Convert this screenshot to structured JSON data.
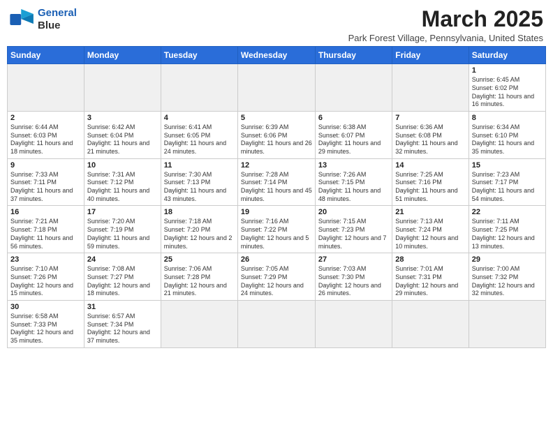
{
  "logo": {
    "line1": "General",
    "line2": "Blue"
  },
  "title": "March 2025",
  "location": "Park Forest Village, Pennsylvania, United States",
  "days_of_week": [
    "Sunday",
    "Monday",
    "Tuesday",
    "Wednesday",
    "Thursday",
    "Friday",
    "Saturday"
  ],
  "weeks": [
    [
      {
        "day": "",
        "empty": true
      },
      {
        "day": "",
        "empty": true
      },
      {
        "day": "",
        "empty": true
      },
      {
        "day": "",
        "empty": true
      },
      {
        "day": "",
        "empty": true
      },
      {
        "day": "",
        "empty": true
      },
      {
        "day": "1",
        "sunrise": "6:45 AM",
        "sunset": "6:02 PM",
        "daylight": "11 hours and 16 minutes."
      }
    ],
    [
      {
        "day": "2",
        "sunrise": "6:44 AM",
        "sunset": "6:03 PM",
        "daylight": "11 hours and 18 minutes."
      },
      {
        "day": "3",
        "sunrise": "6:42 AM",
        "sunset": "6:04 PM",
        "daylight": "11 hours and 21 minutes."
      },
      {
        "day": "4",
        "sunrise": "6:41 AM",
        "sunset": "6:05 PM",
        "daylight": "11 hours and 24 minutes."
      },
      {
        "day": "5",
        "sunrise": "6:39 AM",
        "sunset": "6:06 PM",
        "daylight": "11 hours and 26 minutes."
      },
      {
        "day": "6",
        "sunrise": "6:38 AM",
        "sunset": "6:07 PM",
        "daylight": "11 hours and 29 minutes."
      },
      {
        "day": "7",
        "sunrise": "6:36 AM",
        "sunset": "6:08 PM",
        "daylight": "11 hours and 32 minutes."
      },
      {
        "day": "8",
        "sunrise": "6:34 AM",
        "sunset": "6:10 PM",
        "daylight": "11 hours and 35 minutes."
      }
    ],
    [
      {
        "day": "9",
        "sunrise": "7:33 AM",
        "sunset": "7:11 PM",
        "daylight": "11 hours and 37 minutes."
      },
      {
        "day": "10",
        "sunrise": "7:31 AM",
        "sunset": "7:12 PM",
        "daylight": "11 hours and 40 minutes."
      },
      {
        "day": "11",
        "sunrise": "7:30 AM",
        "sunset": "7:13 PM",
        "daylight": "11 hours and 43 minutes."
      },
      {
        "day": "12",
        "sunrise": "7:28 AM",
        "sunset": "7:14 PM",
        "daylight": "11 hours and 45 minutes."
      },
      {
        "day": "13",
        "sunrise": "7:26 AM",
        "sunset": "7:15 PM",
        "daylight": "11 hours and 48 minutes."
      },
      {
        "day": "14",
        "sunrise": "7:25 AM",
        "sunset": "7:16 PM",
        "daylight": "11 hours and 51 minutes."
      },
      {
        "day": "15",
        "sunrise": "7:23 AM",
        "sunset": "7:17 PM",
        "daylight": "11 hours and 54 minutes."
      }
    ],
    [
      {
        "day": "16",
        "sunrise": "7:21 AM",
        "sunset": "7:18 PM",
        "daylight": "11 hours and 56 minutes."
      },
      {
        "day": "17",
        "sunrise": "7:20 AM",
        "sunset": "7:19 PM",
        "daylight": "11 hours and 59 minutes."
      },
      {
        "day": "18",
        "sunrise": "7:18 AM",
        "sunset": "7:20 PM",
        "daylight": "12 hours and 2 minutes."
      },
      {
        "day": "19",
        "sunrise": "7:16 AM",
        "sunset": "7:22 PM",
        "daylight": "12 hours and 5 minutes."
      },
      {
        "day": "20",
        "sunrise": "7:15 AM",
        "sunset": "7:23 PM",
        "daylight": "12 hours and 7 minutes."
      },
      {
        "day": "21",
        "sunrise": "7:13 AM",
        "sunset": "7:24 PM",
        "daylight": "12 hours and 10 minutes."
      },
      {
        "day": "22",
        "sunrise": "7:11 AM",
        "sunset": "7:25 PM",
        "daylight": "12 hours and 13 minutes."
      }
    ],
    [
      {
        "day": "23",
        "sunrise": "7:10 AM",
        "sunset": "7:26 PM",
        "daylight": "12 hours and 15 minutes."
      },
      {
        "day": "24",
        "sunrise": "7:08 AM",
        "sunset": "7:27 PM",
        "daylight": "12 hours and 18 minutes."
      },
      {
        "day": "25",
        "sunrise": "7:06 AM",
        "sunset": "7:28 PM",
        "daylight": "12 hours and 21 minutes."
      },
      {
        "day": "26",
        "sunrise": "7:05 AM",
        "sunset": "7:29 PM",
        "daylight": "12 hours and 24 minutes."
      },
      {
        "day": "27",
        "sunrise": "7:03 AM",
        "sunset": "7:30 PM",
        "daylight": "12 hours and 26 minutes."
      },
      {
        "day": "28",
        "sunrise": "7:01 AM",
        "sunset": "7:31 PM",
        "daylight": "12 hours and 29 minutes."
      },
      {
        "day": "29",
        "sunrise": "7:00 AM",
        "sunset": "7:32 PM",
        "daylight": "12 hours and 32 minutes."
      }
    ],
    [
      {
        "day": "30",
        "sunrise": "6:58 AM",
        "sunset": "7:33 PM",
        "daylight": "12 hours and 35 minutes."
      },
      {
        "day": "31",
        "sunrise": "6:57 AM",
        "sunset": "7:34 PM",
        "daylight": "12 hours and 37 minutes."
      },
      {
        "day": "",
        "empty": true
      },
      {
        "day": "",
        "empty": true
      },
      {
        "day": "",
        "empty": true
      },
      {
        "day": "",
        "empty": true
      },
      {
        "day": "",
        "empty": true
      }
    ]
  ]
}
